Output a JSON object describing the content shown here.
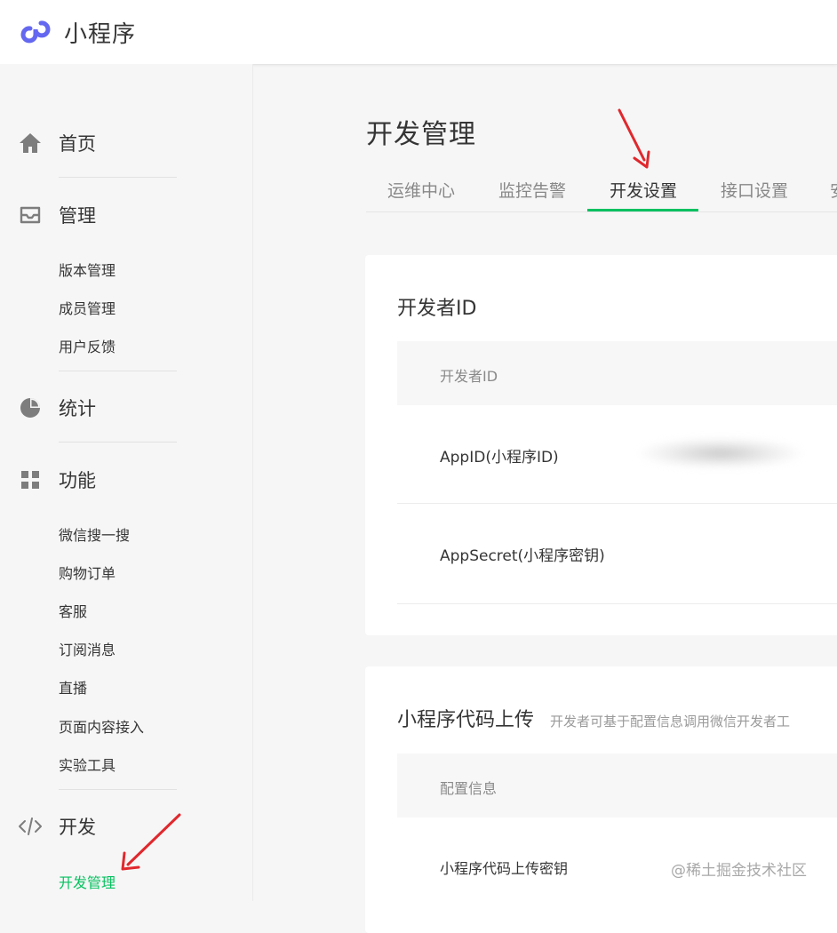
{
  "brand": {
    "name": "小程序",
    "logo_icon": "mini-program-logo",
    "accent": "#6467f0"
  },
  "sidebar": {
    "groups": [
      {
        "label": "首页",
        "icon": "home-icon"
      },
      {
        "label": "管理",
        "icon": "inbox-icon",
        "items": [
          "版本管理",
          "成员管理",
          "用户反馈"
        ]
      },
      {
        "label": "统计",
        "icon": "pie-chart-icon"
      },
      {
        "label": "功能",
        "icon": "grid-icon",
        "items": [
          "微信搜一搜",
          "购物订单",
          "客服",
          "订阅消息",
          "直播",
          "页面内容接入",
          "实验工具"
        ]
      },
      {
        "label": "开发",
        "icon": "code-icon",
        "items": [
          "开发管理"
        ]
      }
    ],
    "active_item": "开发管理"
  },
  "main": {
    "title": "开发管理",
    "tabs": [
      "运维中心",
      "监控告警",
      "开发设置",
      "接口设置",
      "安"
    ],
    "active_tab": "开发设置",
    "developer_id_card": {
      "title": "开发者ID",
      "table_header": "开发者ID",
      "rows": [
        {
          "label": "AppID(小程序ID)",
          "value_blurred": true
        },
        {
          "label": "AppSecret(小程序密钥)"
        }
      ]
    },
    "upload_card": {
      "title": "小程序代码上传",
      "description": "开发者可基于配置信息调用微信开发者工",
      "table_header": "配置信息",
      "rows": [
        {
          "label": "小程序代码上传密钥"
        }
      ]
    }
  },
  "watermark": "@稀土掘金技术社区",
  "colors": {
    "active_green": "#07c160",
    "arrow_red": "#e0282d"
  }
}
